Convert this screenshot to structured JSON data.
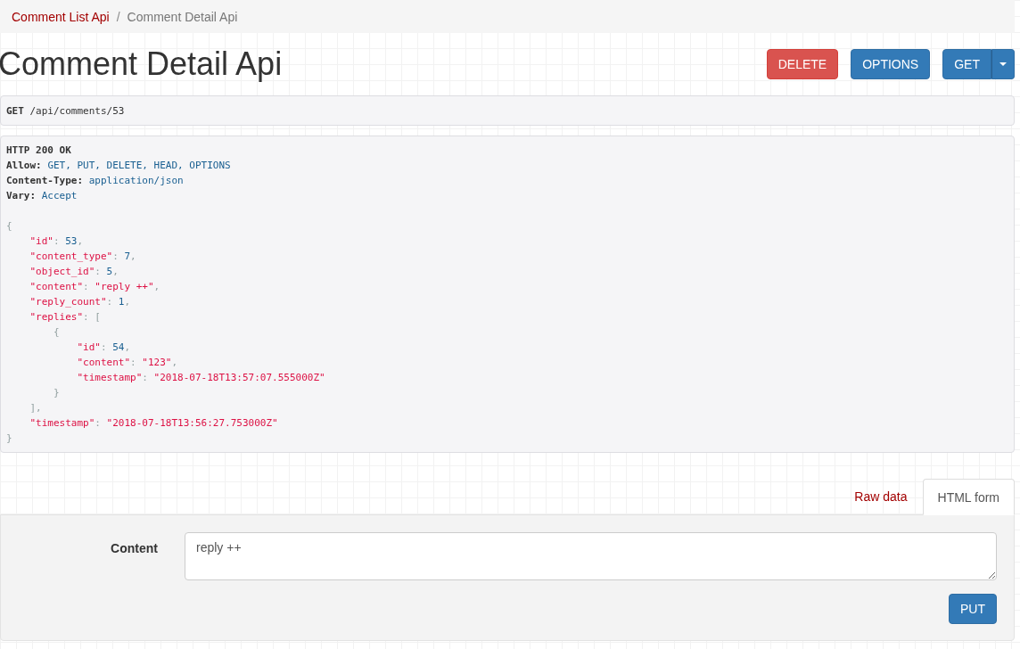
{
  "breadcrumb": [
    {
      "label": "Comment List Api",
      "selected": false
    },
    {
      "label": "Comment Detail Api",
      "selected": true
    }
  ],
  "breadcrumb_separator": "/",
  "title": "Comment Detail Api",
  "actions": [
    {
      "label": "DELETE",
      "kind": "danger"
    },
    {
      "label": "OPTIONS",
      "kind": "primary"
    },
    {
      "label": "GET",
      "kind": "split"
    }
  ],
  "request": {
    "method": "GET",
    "path": "/api/comments/53"
  },
  "response": {
    "status": "HTTP 200 OK",
    "headers": [
      {
        "name": "Allow:",
        "value": "GET, PUT, DELETE, HEAD, OPTIONS"
      },
      {
        "name": "Content-Type:",
        "value": "application/json"
      },
      {
        "name": "Vary:",
        "value": "Accept"
      }
    ],
    "body": [
      [
        {
          "kind": "punct",
          "text": "{"
        }
      ],
      [
        {
          "kind": "string",
          "text": "    \"id\""
        },
        {
          "kind": "punct",
          "text": ": "
        },
        {
          "kind": "number",
          "text": "53"
        },
        {
          "kind": "punct",
          "text": ","
        }
      ],
      [
        {
          "kind": "string",
          "text": "    \"content_type\""
        },
        {
          "kind": "punct",
          "text": ": "
        },
        {
          "kind": "number",
          "text": "7"
        },
        {
          "kind": "punct",
          "text": ","
        }
      ],
      [
        {
          "kind": "string",
          "text": "    \"object_id\""
        },
        {
          "kind": "punct",
          "text": ": "
        },
        {
          "kind": "number",
          "text": "5"
        },
        {
          "kind": "punct",
          "text": ","
        }
      ],
      [
        {
          "kind": "string",
          "text": "    \"content\""
        },
        {
          "kind": "punct",
          "text": ": "
        },
        {
          "kind": "string",
          "text": "\"reply ++\""
        },
        {
          "kind": "punct",
          "text": ","
        }
      ],
      [
        {
          "kind": "string",
          "text": "    \"reply_count\""
        },
        {
          "kind": "punct",
          "text": ": "
        },
        {
          "kind": "number",
          "text": "1"
        },
        {
          "kind": "punct",
          "text": ","
        }
      ],
      [
        {
          "kind": "string",
          "text": "    \"replies\""
        },
        {
          "kind": "punct",
          "text": ": ["
        }
      ],
      [
        {
          "kind": "punct",
          "text": "        {"
        }
      ],
      [
        {
          "kind": "string",
          "text": "            \"id\""
        },
        {
          "kind": "punct",
          "text": ": "
        },
        {
          "kind": "number",
          "text": "54"
        },
        {
          "kind": "punct",
          "text": ","
        }
      ],
      [
        {
          "kind": "string",
          "text": "            \"content\""
        },
        {
          "kind": "punct",
          "text": ": "
        },
        {
          "kind": "string",
          "text": "\"123\""
        },
        {
          "kind": "punct",
          "text": ","
        }
      ],
      [
        {
          "kind": "string",
          "text": "            \"timestamp\""
        },
        {
          "kind": "punct",
          "text": ": "
        },
        {
          "kind": "string",
          "text": "\"2018-07-18T13:57:07.555000Z\""
        }
      ],
      [
        {
          "kind": "punct",
          "text": "        }"
        }
      ],
      [
        {
          "kind": "punct",
          "text": "    ],"
        }
      ],
      [
        {
          "kind": "string",
          "text": "    \"timestamp\""
        },
        {
          "kind": "punct",
          "text": ": "
        },
        {
          "kind": "string",
          "text": "\"2018-07-18T13:56:27.753000Z\""
        }
      ],
      [
        {
          "kind": "punct",
          "text": "}"
        }
      ]
    ]
  },
  "tabs": [
    {
      "label": "Raw data",
      "selected": false
    },
    {
      "label": "HTML form",
      "selected": true
    }
  ],
  "form": {
    "fields": [
      {
        "label": "Content",
        "value": "reply ++"
      }
    ],
    "submit": "PUT"
  }
}
